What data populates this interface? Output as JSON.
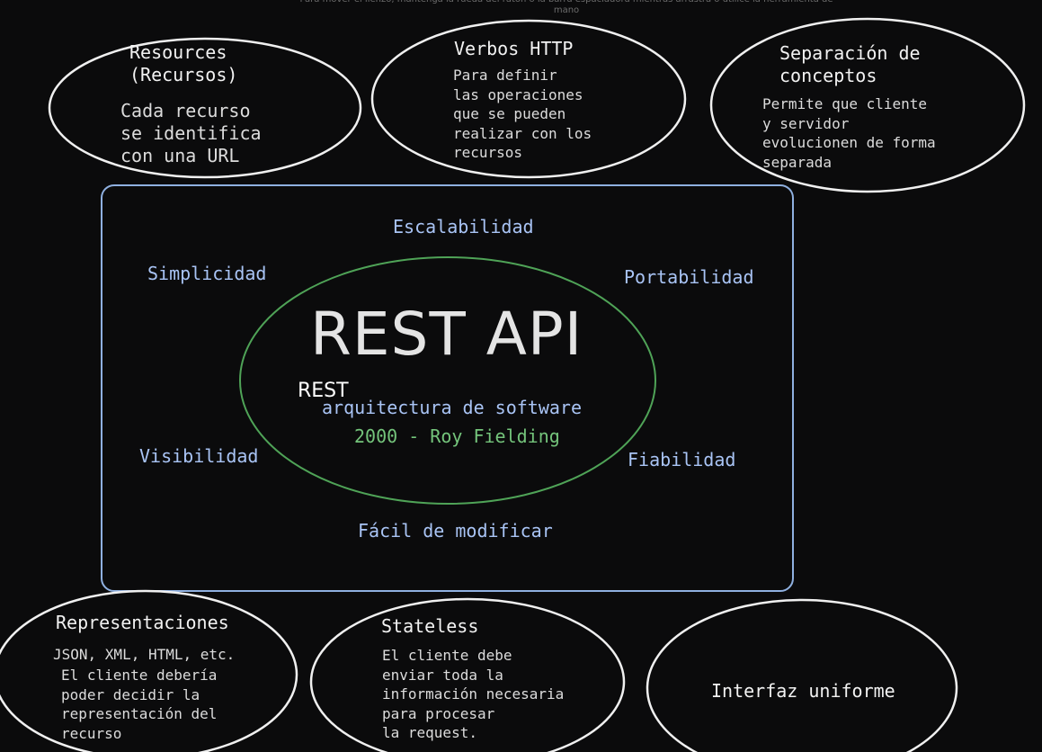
{
  "hint_text": "Para mover el lienzo, mantenga la rueda del ratón o la barra espaciadora mientras arrastra o utilice la herramienta de mano",
  "center": {
    "title": "REST API",
    "rest_label": "REST",
    "subtitle": "arquitectura de software",
    "origin": "2000 - Roy Fielding"
  },
  "properties": {
    "escalabilidad": "Escalabilidad",
    "simplicidad": "Simplicidad",
    "portabilidad": "Portabilidad",
    "visibilidad": "Visibilidad",
    "fiabilidad": "Fiabilidad",
    "facil": "Fácil de modificar"
  },
  "bubbles": {
    "resources": {
      "title": "Resources\n(Recursos)",
      "body": "Cada recurso\nse identifica\ncon una URL"
    },
    "verbos": {
      "title": "Verbos HTTP",
      "body": "Para definir\nlas operaciones\nque se pueden\nrealizar con los\nrecursos"
    },
    "separacion": {
      "title": "Separación de\nconceptos",
      "body": "Permite que cliente\ny servidor\nevolucionen de forma\nseparada"
    },
    "representaciones": {
      "title": "Representaciones",
      "body_line1": "JSON, XML, HTML, etc.",
      "body": "El cliente debería\npoder decidir la\nrepresentación del\nrecurso"
    },
    "stateless": {
      "title": "Stateless",
      "body": "El cliente debe\nenviar toda la\ninformación necesaria\npara procesar\nla request."
    },
    "interfaz": {
      "title": "Interfaz uniforme"
    }
  },
  "colors": {
    "background": "#0b0b0c",
    "ellipse_stroke": "#f0f0f0",
    "box_stroke": "#8fb0e0",
    "center_ellipse": "#4fa357",
    "blue_text": "#a9c4f5",
    "green_text": "#74c47b"
  }
}
